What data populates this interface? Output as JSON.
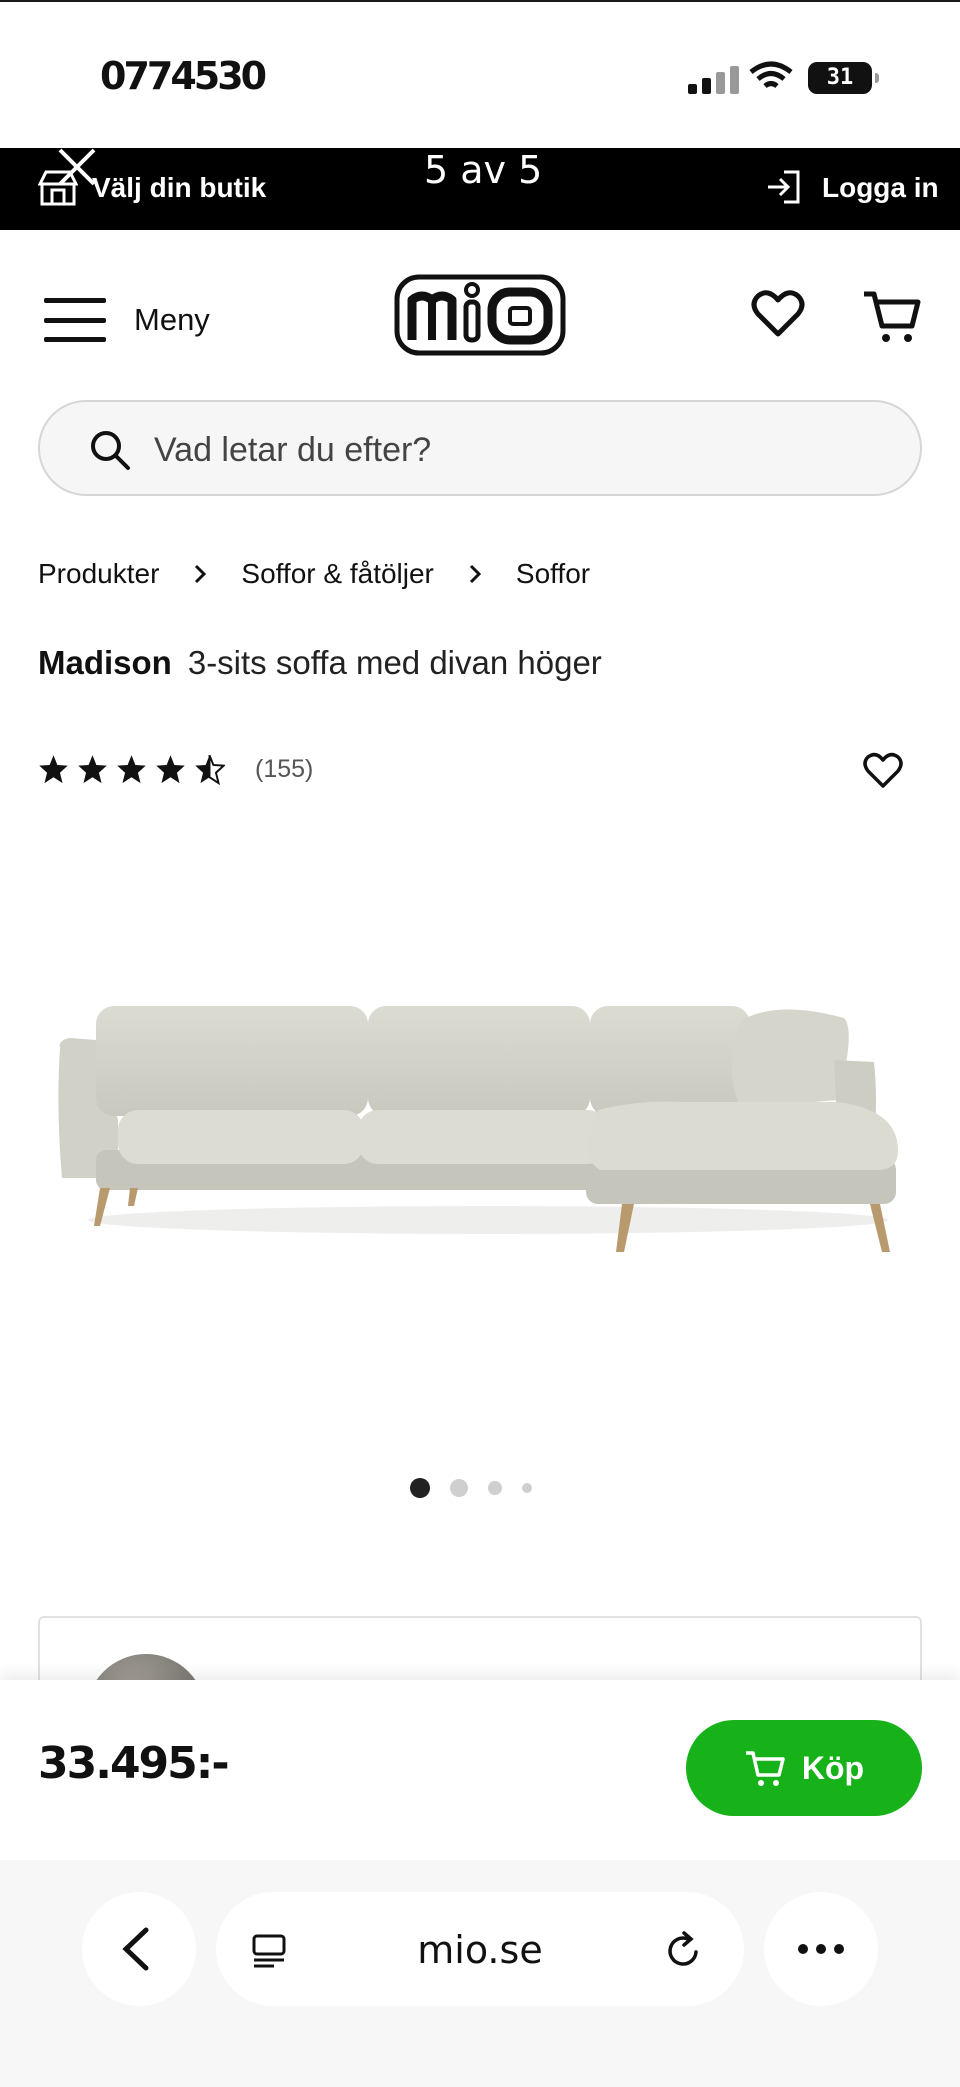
{
  "status_bar": {
    "time": "0774530",
    "battery": "31"
  },
  "top_bar": {
    "store_label": "Välj din butik",
    "image_counter": "5 av 5",
    "login_label": "Logga in"
  },
  "header": {
    "menu_label": "Meny",
    "logo_text": "mio"
  },
  "search": {
    "placeholder": "Vad letar du efter?"
  },
  "breadcrumb": [
    "Produkter",
    "Soffor & fåtöljer",
    "Soffor"
  ],
  "product": {
    "brand": "Madison",
    "description": "3-sits soffa med divan höger",
    "rating": 4.5,
    "rating_max": 5,
    "review_count": "(155)",
    "image_icon": "sofa-image",
    "carousel_pages": 4,
    "carousel_active": 1
  },
  "buy_bar": {
    "price": "33.495:-",
    "buy_label": "Köp",
    "accent_color": "#17b21a"
  },
  "browser": {
    "url": "mio.se"
  }
}
